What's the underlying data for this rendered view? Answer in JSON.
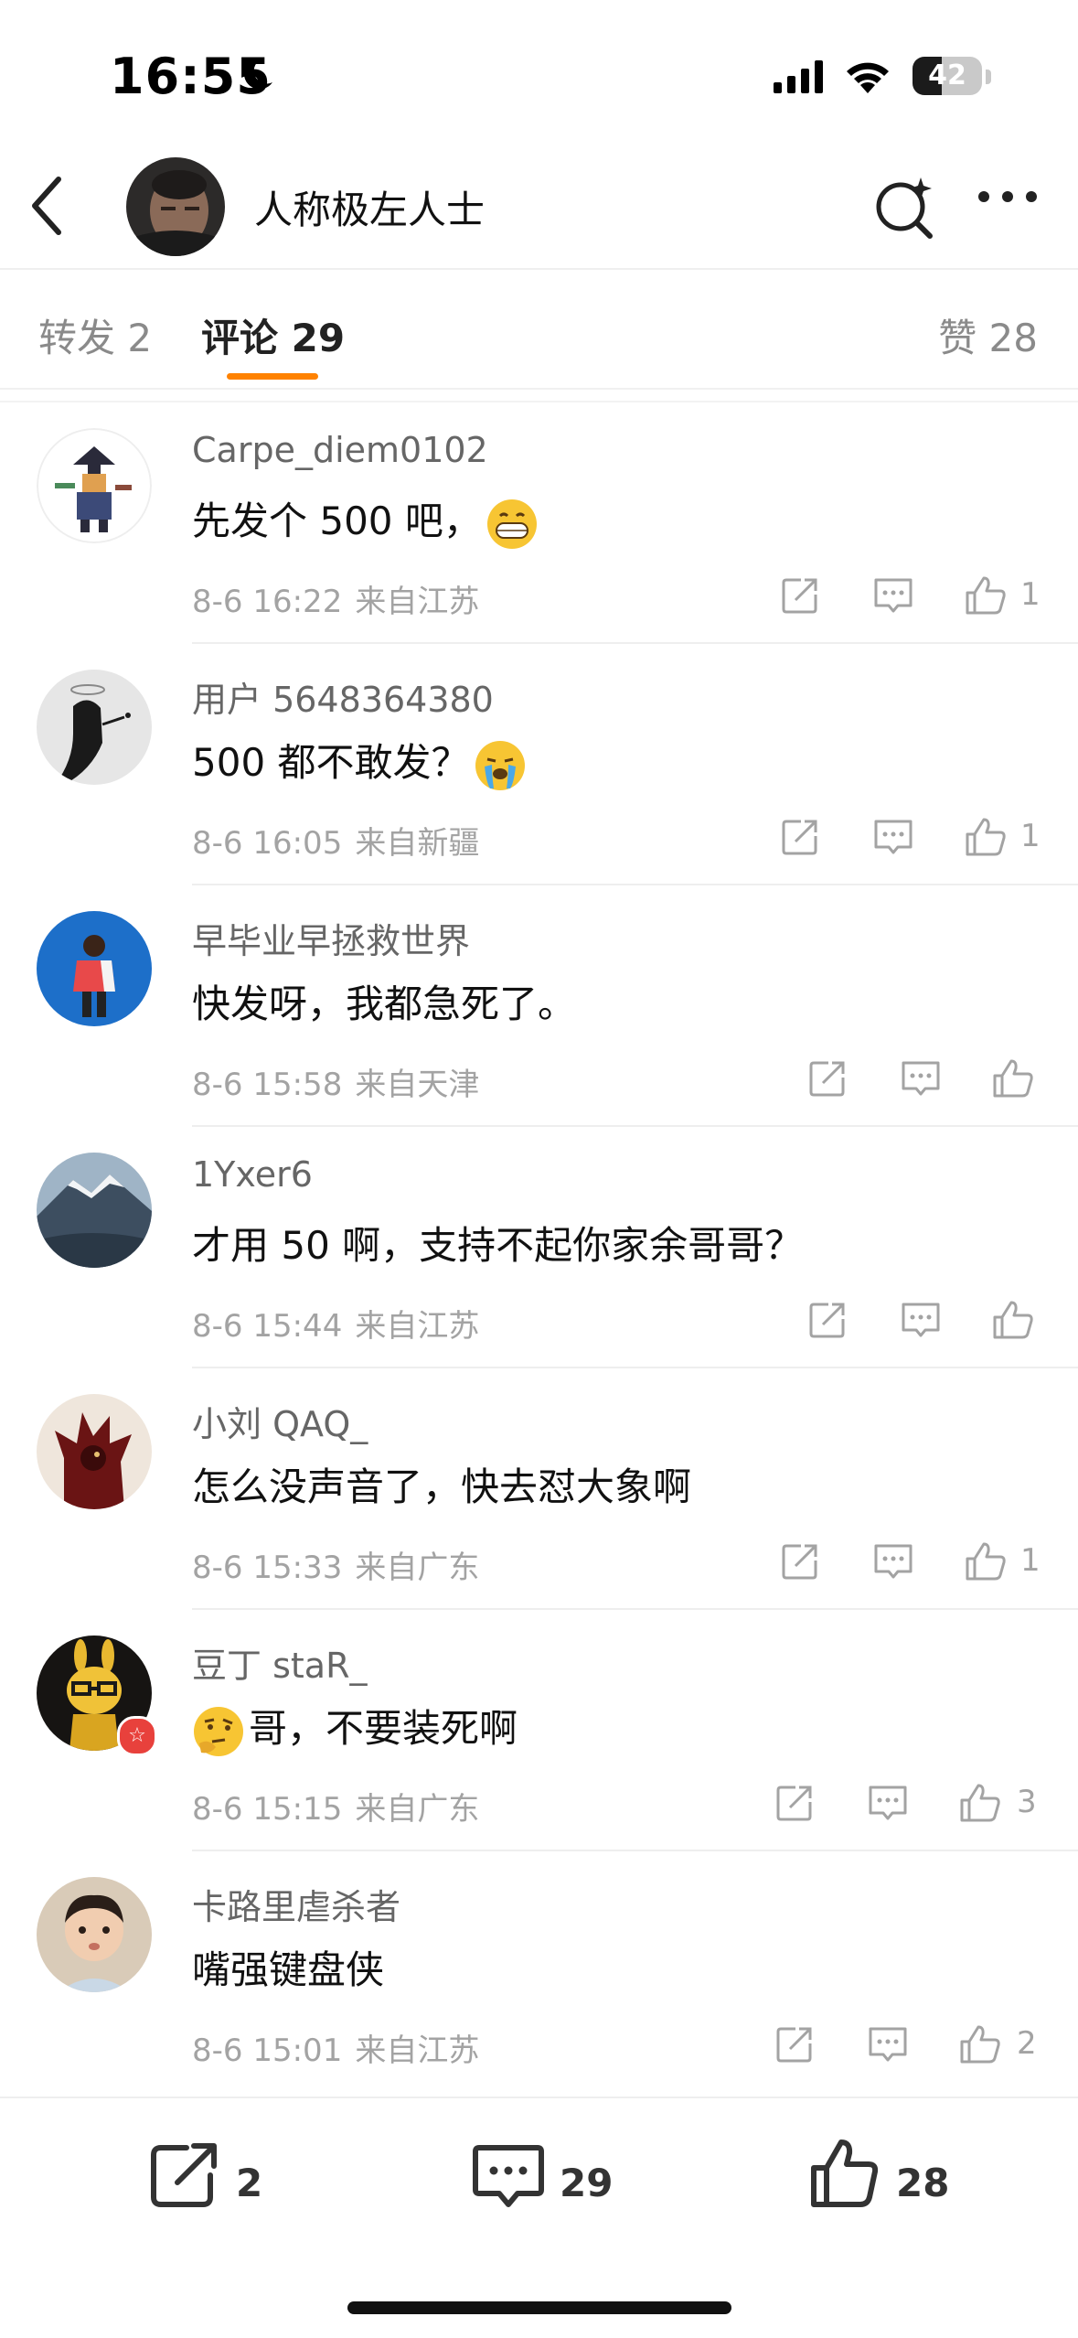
{
  "status_bar": {
    "time": "16:55",
    "battery": "42",
    "battery_level": 0.42
  },
  "header": {
    "title": "人称极左人士"
  },
  "tabs": {
    "repost": "转发 2",
    "comments": "评论 29",
    "likes": "赞 28"
  },
  "comments": [
    {
      "name": "Carpe_diem0102",
      "text": "先发个 500 吧，",
      "emoji": "grinning-face-emoji",
      "date": "8-6 16:22",
      "location": "来自江苏",
      "likes": "1"
    },
    {
      "name": "用户 5648364380",
      "text": "500 都不敢发？",
      "emoji": "crying-face-emoji",
      "date": "8-6 16:05",
      "location": "来自新疆",
      "likes": "1"
    },
    {
      "name": "早毕业早拯救世界",
      "text": "快发呀，我都急死了。",
      "date": "8-6 15:58",
      "location": "来自天津",
      "likes": ""
    },
    {
      "name": "1Yxer6",
      "text": "才用 50 啊，支持不起你家余哥哥？",
      "date": "8-6 15:44",
      "location": "来自江苏",
      "likes": ""
    },
    {
      "name": "小刘 QAQ_",
      "text": "怎么没声音了，快去怼大象啊",
      "date": "8-6 15:33",
      "location": "来自广东",
      "likes": "1"
    },
    {
      "name": "豆丁 staR_",
      "text": "哥，不要装死啊",
      "emoji": "thinking-face-emoji",
      "date": "8-6 15:15",
      "location": "来自广东",
      "likes": "3"
    },
    {
      "name": "卡路里虐杀者",
      "text": "嘴强键盘侠",
      "date": "8-6 15:01",
      "location": "来自江苏",
      "likes": "2"
    }
  ],
  "bottom_bar": {
    "reposts": "2",
    "comments": "29",
    "likes": "28"
  },
  "colors": {
    "accent": "#ff8200",
    "vip_badge": "#e8413c"
  }
}
